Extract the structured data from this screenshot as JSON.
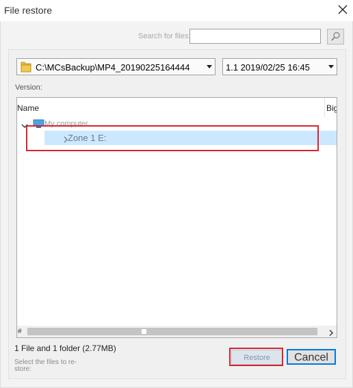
{
  "window": {
    "title": "File restore"
  },
  "search": {
    "label": "Search for files:",
    "placeholder": "",
    "value": ""
  },
  "path_select": {
    "value": "C:\\MCsBackup\\MP4_20190225164444"
  },
  "version_select": {
    "value": "1.1   2019/02/25 16:45"
  },
  "version_label": "Version:",
  "tree": {
    "columns": [
      "Name",
      "Big"
    ],
    "root": {
      "label": "My computer",
      "expanded": true
    },
    "items": [
      {
        "label": "Zone 1 E:",
        "selected": true
      }
    ]
  },
  "scrollbar": {
    "hash_label": "#"
  },
  "summary": "1 File and 1 folder (2.77MB)",
  "hint": "Select the files to re-store:",
  "buttons": {
    "restore": "Restore",
    "cancel": "Cancel"
  },
  "colors": {
    "highlight": "#d9232d",
    "selection": "#cce8ff",
    "focus": "#0078d7"
  }
}
